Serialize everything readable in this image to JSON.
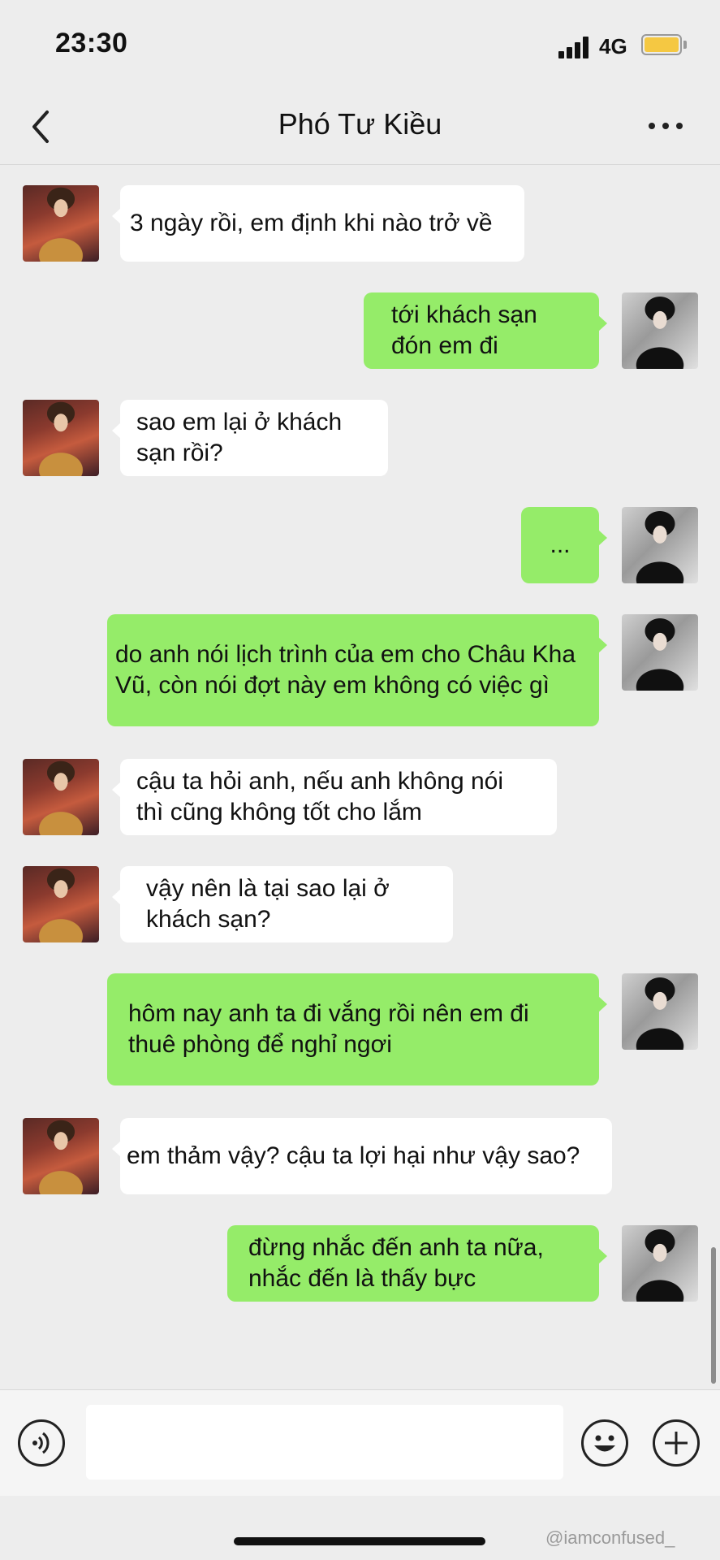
{
  "status_bar": {
    "time": "23:30",
    "network": "4G",
    "signal_icon": "signal-bars-icon",
    "battery_icon": "battery-icon",
    "battery_color": "#f5c842"
  },
  "nav": {
    "title": "Phó Tư Kiều",
    "back_icon": "chevron-left-icon",
    "more_icon": "more-dots-icon"
  },
  "messages": [
    {
      "side": "left",
      "text": "3 ngày rồi, em định khi nào trở về"
    },
    {
      "side": "right",
      "text": "tới khách sạn\nđón em đi"
    },
    {
      "side": "left",
      "text": "sao em lại ở khách\nsạn rồi?"
    },
    {
      "side": "right",
      "text": "..."
    },
    {
      "side": "right",
      "text": "do anh nói lịch trình của em cho Châu Kha\nVũ, còn nói đợt này em không có việc gì"
    },
    {
      "side": "left",
      "text": "cậu ta hỏi anh, nếu anh không nói\nthì cũng không tốt cho lắm"
    },
    {
      "side": "left",
      "text": "vậy nên là tại sao lại ở\nkhách sạn?"
    },
    {
      "side": "right",
      "text": "hôm nay anh ta đi vắng rồi nên em đi\nthuê phòng để nghỉ ngơi"
    },
    {
      "side": "left",
      "text": "em thảm vậy? cậu ta lợi hại như vậy sao?"
    },
    {
      "side": "right",
      "text": "đừng nhắc đến anh ta nữa,\nnhắc đến là thấy bực"
    }
  ],
  "input_bar": {
    "placeholder": "",
    "voice_icon": "voice-icon",
    "emoji_icon": "emoji-icon",
    "add_icon": "plus-icon"
  },
  "watermark": {
    "handle": "@iamconfused_"
  },
  "colors": {
    "background": "#ededed",
    "incoming_bubble": "#ffffff",
    "outgoing_bubble": "#95ec69"
  }
}
